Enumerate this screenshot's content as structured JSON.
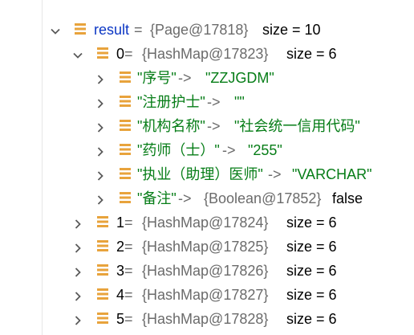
{
  "colors": {
    "variable_name": "#0b36c4",
    "string_value": "#067d17",
    "object_ref": "#6b6b6b",
    "field_icon": "#e8a33c",
    "chevron": "#5a5a5a"
  },
  "tree": {
    "root": {
      "name": "result",
      "eq": " = ",
      "ref": "{Page@17818}",
      "size": "size = 10",
      "expanded": true,
      "icon": "field-icon"
    },
    "child0": {
      "name": "0",
      "eq": " = ",
      "ref": "{HashMap@17823}",
      "size": "size = 6",
      "expanded": true,
      "entries": [
        {
          "key": "\"序号\"",
          "arrow": " -> ",
          "value": "\"ZZJGDM\""
        },
        {
          "key": "\"注册护士\"",
          "arrow": " -> ",
          "value": "\"\""
        },
        {
          "key": "\"机构名称\"",
          "arrow": " -> ",
          "value": "\"社会统一信用代码\""
        },
        {
          "key": "\"药师（士）\"",
          "arrow": " -> ",
          "value": "\"255\""
        },
        {
          "key": "\"执业（助理）医师\"",
          "arrow": " -> ",
          "value": "\"VARCHAR\""
        },
        {
          "key": "\"备注\"",
          "arrow": " -> ",
          "value_ref": "{Boolean@17852}",
          "value": "false"
        }
      ]
    },
    "siblings": [
      {
        "name": "1",
        "eq": " = ",
        "ref": "{HashMap@17824}",
        "size": "size = 6"
      },
      {
        "name": "2",
        "eq": " = ",
        "ref": "{HashMap@17825}",
        "size": "size = 6"
      },
      {
        "name": "3",
        "eq": " = ",
        "ref": "{HashMap@17826}",
        "size": "size = 6"
      },
      {
        "name": "4",
        "eq": " = ",
        "ref": "{HashMap@17827}",
        "size": "size = 6"
      },
      {
        "name": "5",
        "eq": " = ",
        "ref": "{HashMap@17828}",
        "size": "size = 6"
      }
    ]
  }
}
